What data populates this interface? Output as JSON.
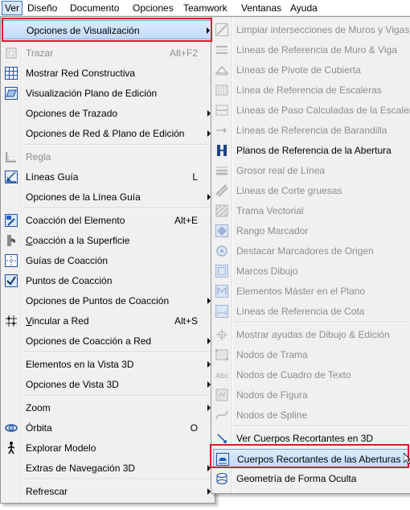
{
  "menubar": [
    {
      "key": "ver",
      "label": "Ver"
    },
    {
      "key": "diseno",
      "label": "Diseño"
    },
    {
      "key": "documento",
      "label": "Documento"
    },
    {
      "key": "opciones",
      "label": "Opciones"
    },
    {
      "key": "teamwork",
      "label": "Teamwork"
    },
    {
      "key": "ventanas",
      "label": "Ventanas"
    },
    {
      "key": "ayuda",
      "label": "Ayuda"
    }
  ],
  "menu": {
    "opciones_visualizacion": "Opciones de Visualización",
    "trazar": "Trazar",
    "trazar_sc": "Alt+F2",
    "mostrar_red": "Mostrar Red Constructiva",
    "visualizacion_plano": "Visualización Plano de Edición",
    "opciones_trazado": "Opciones de Trazado",
    "opciones_red_plano": "Opciones de Red & Plano de Edición",
    "regla": "Regla",
    "lineas_guia": "Líneas Guía",
    "lineas_guia_sc": "L",
    "opciones_linea_guia": "Opciones de la Línea Guía",
    "coaccion_elemento": "Coacción del Elemento",
    "coaccion_elemento_sc": "Alt+E",
    "coaccion_superficie": "Coacción a la Superficie",
    "guias_coaccion": "Guías de Coacción",
    "puntos_coaccion": "Puntos de Coacción",
    "opciones_puntos_coaccion": "Opciones de Puntos de Coacción",
    "vincular_red": "Vincular a Red",
    "vincular_red_sc": "Alt+S",
    "opciones_coaccion_red": "Opciones de Coacción a Red",
    "elementos_vista_3d": "Elementos en la Vista 3D",
    "opciones_vista_3d": "Opciones de Vista 3D",
    "zoom": "Zoom",
    "orbita": "Órbita",
    "orbita_sc": "O",
    "explorar_modelo": "Explorar Modelo",
    "extras_navegacion": "Extras de Navegación 3D",
    "refrescar": "Refrescar"
  },
  "submenu": {
    "limpiar_intersecciones": "Limpiar intersecciones de Muros y Vigas",
    "lineas_ref_muro": "Líneas de Referencia de Muro & Viga",
    "lineas_pivote": "Líneas de Pivote de Cubierta",
    "linea_ref_escaleras": "Línea de Referencia de Escaleras",
    "lineas_paso": "Líneas de Paso Calculadas de la Escalera",
    "lineas_ref_barandilla": "Líneas de Referencia de Barandilla",
    "planos_ref_abertura": "Planos de Referencia de la Abertura",
    "grosor_real": "Grosor real de Línea",
    "lineas_corte": "Líneas de Corte gruesas",
    "trama_vectorial": "Trama Vectorial",
    "rango_marcador": "Rango Marcador",
    "destacar_marcadores": "Destacar Marcadores de Origen",
    "marcos_dibujo": "Marcos Dibujo",
    "elementos_master": "Elementos Máster en el Plano",
    "lineas_ref_cota": "Líneas de Referencia de Cota",
    "mostrar_ayudas": "Mostrar ayudas de Dibujo & Edición",
    "nodos_trama": "Nodos de Trama",
    "nodos_cuadro_texto": "Nodos de Cuadro de Texto",
    "nodos_figura": "Nodos de Figura",
    "nodos_spline": "Nodos de Spline",
    "ver_cuerpos_recortantes": "Ver Cuerpos Recortantes en 3D",
    "cuerpos_recortantes_aberturas": "Cuerpos Recortantes de las Aberturas",
    "geometria_forma_oculta": "Geometría de Forma Oculta"
  },
  "colors": {
    "highlight_border": "#7da2ce",
    "red_box": "#e0182d",
    "icon_blue": "#1f5fbf"
  }
}
